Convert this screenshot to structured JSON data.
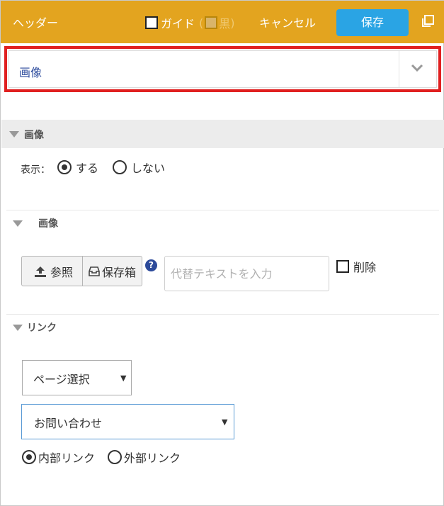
{
  "header": {
    "title": "ヘッダー",
    "guide_label": "ガイド",
    "guide_paren_open": "(",
    "guide_black_label": "黒",
    "guide_paren_close": ")",
    "cancel_label": "キャンセル",
    "save_label": "保存"
  },
  "block_select": {
    "value": "画像"
  },
  "section": {
    "title": "画像"
  },
  "display": {
    "label": "表示：",
    "option_on": "する",
    "option_off": "しない",
    "selected": "する"
  },
  "image": {
    "title": "画像",
    "browse_label": "参照",
    "storage_label": "保存箱",
    "help_icon": "?",
    "alt_placeholder": "代替テキストを入力",
    "delete_label": "削除"
  },
  "link": {
    "title": "リンク",
    "page_select": "ページ選択",
    "page_value": "お問い合わせ",
    "internal_label": "内部リンク",
    "external_label": "外部リンク",
    "selected": "内部リンク"
  },
  "colors": {
    "header_bg": "#e3a41f",
    "save_bg": "#2aa4e4",
    "highlight": "#e02020"
  }
}
